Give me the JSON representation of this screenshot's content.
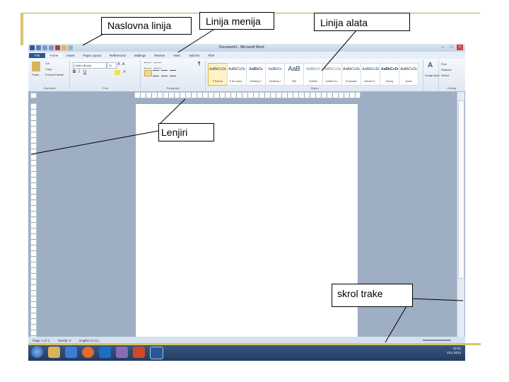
{
  "callouts": {
    "title_bar": "Naslovna linija",
    "menu_bar": "Linija menija",
    "tool_bar": "Linija alata",
    "rulers": "Lenjiri",
    "scroll_bars": "skrol trake"
  },
  "word": {
    "window_title": "Document1 - Microsoft Word",
    "menu": [
      "File",
      "Home",
      "Insert",
      "Page Layout",
      "References",
      "Mailings",
      "Review",
      "View",
      "Add-Ins",
      "PDF"
    ],
    "clipboard": {
      "paste": "Paste",
      "cut": "Cut",
      "copy": "Copy",
      "format_painter": "Format Painter",
      "label": "Clipboard"
    },
    "font": {
      "name": "Calibri (Body)",
      "size": "11",
      "label": "Font"
    },
    "paragraph": {
      "label": "Paragraph"
    },
    "styles": {
      "label": "Styles",
      "items": [
        {
          "sample": "AaBbCcDc",
          "name": "¶ Normal"
        },
        {
          "sample": "AaBbCcDc",
          "name": "¶ No Spaci..."
        },
        {
          "sample": "AaBbCc",
          "name": "Heading 1"
        },
        {
          "sample": "AaBbCc",
          "name": "Heading 2"
        },
        {
          "sample": "AaB",
          "name": "Title"
        },
        {
          "sample": "AaBbCcI",
          "name": "Subtitle"
        },
        {
          "sample": "AaBbCcDc",
          "name": "Subtle Em..."
        },
        {
          "sample": "AaBbCcDc",
          "name": "Emphasis"
        },
        {
          "sample": "AaBbCcDc",
          "name": "Intense E..."
        },
        {
          "sample": "AaBbCcDc",
          "name": "Strong"
        },
        {
          "sample": "AaBbCcDc",
          "name": "Quote"
        }
      ],
      "change_styles": "Change Styles"
    },
    "editing": {
      "find": "Find",
      "replace": "Replace",
      "select": "Select",
      "label": "Editing"
    },
    "status": {
      "page": "Page: 1 of 1",
      "words": "Words: 0",
      "language": "English (U.S.)"
    },
    "taskbar": {
      "time": "12:41",
      "date": "13.1.2014"
    }
  }
}
